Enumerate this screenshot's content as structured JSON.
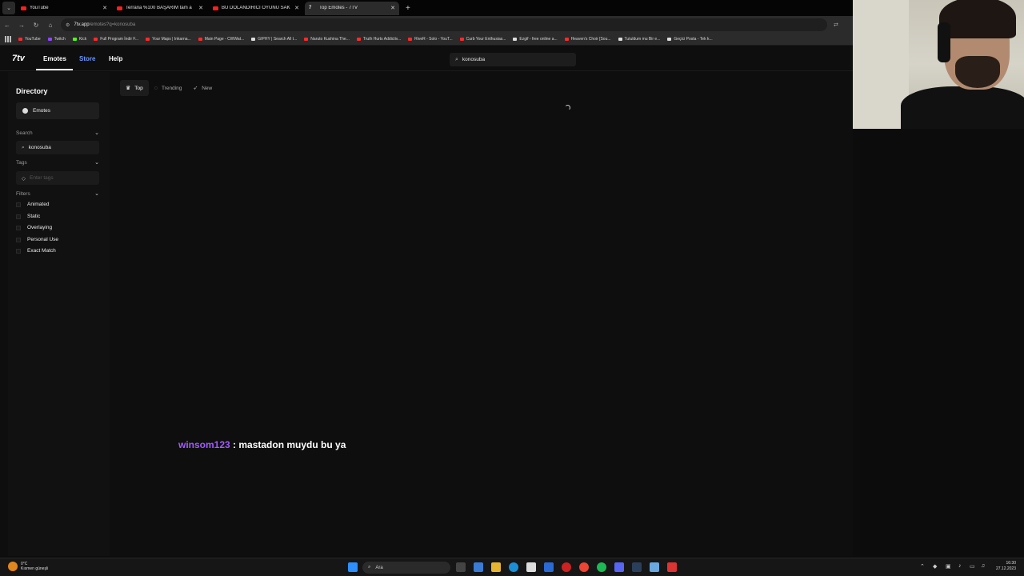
{
  "browser": {
    "tabs": [
      {
        "title": "YouTube",
        "active": false
      },
      {
        "title": "Terraria %100 BAŞARIM tam a",
        "active": false
      },
      {
        "title": "BU DOLANDIRICI OYUNU SAK",
        "active": false
      },
      {
        "title": "Top Emotes - 7TV",
        "active": true
      }
    ],
    "url_host": "7tv.app",
    "url_path": "/emotes?q=konosuba",
    "bookmarks": [
      {
        "label": "YouTube",
        "color": "red"
      },
      {
        "label": "Twitch",
        "color": "purple"
      },
      {
        "label": "Kick",
        "color": "green"
      },
      {
        "label": "Full Program İndir F...",
        "color": "red"
      },
      {
        "label": "Your Maps | Inkarna...",
        "color": "red"
      },
      {
        "label": "Main Page - CWWat...",
        "color": "red"
      },
      {
        "label": "GIPHY | Search All t...",
        "color": "white"
      },
      {
        "label": "Naruto Kushina The...",
        "color": "red"
      },
      {
        "label": "Truth Hurts Addictiv...",
        "color": "red"
      },
      {
        "label": "RiveR - Solo - YouT...",
        "color": "red"
      },
      {
        "label": "Curb Your Enthusias...",
        "color": "red"
      },
      {
        "label": "Ezgif - free online a...",
        "color": "white"
      },
      {
        "label": "Heaven's Choir [Sou...",
        "color": "red"
      },
      {
        "label": "Tutuldum mu Bir e...",
        "color": "white"
      },
      {
        "label": "Geçici Posta - Tek k...",
        "color": "white"
      }
    ]
  },
  "header": {
    "logo": "7tv",
    "nav": {
      "emotes": "Emotes",
      "store": "Store",
      "help": "Help"
    },
    "search_value": "konosuba"
  },
  "sidebar": {
    "title": "Directory",
    "item": "Emotes",
    "search_label": "Search",
    "search_value": "konosuba",
    "tags_label": "Tags",
    "tags_placeholder": "Enter tags",
    "filters_label": "Filters",
    "filters": [
      "Animated",
      "Static",
      "Overlaying",
      "Personal Use",
      "Exact Match"
    ]
  },
  "sort_tabs": [
    "Top",
    "Trending",
    "New"
  ],
  "chat": {
    "user": "winsom123",
    "message": " : mastadon muydu bu ya"
  },
  "taskbar": {
    "temperature": "0°C",
    "weather": "Kısmen güneşli",
    "search": "Ara",
    "time": "16:30",
    "date": "27.12.2023"
  },
  "colors": {
    "store_link": "#6a96ff",
    "chat_user": "#a45cff",
    "background": "#0e0e0e"
  }
}
